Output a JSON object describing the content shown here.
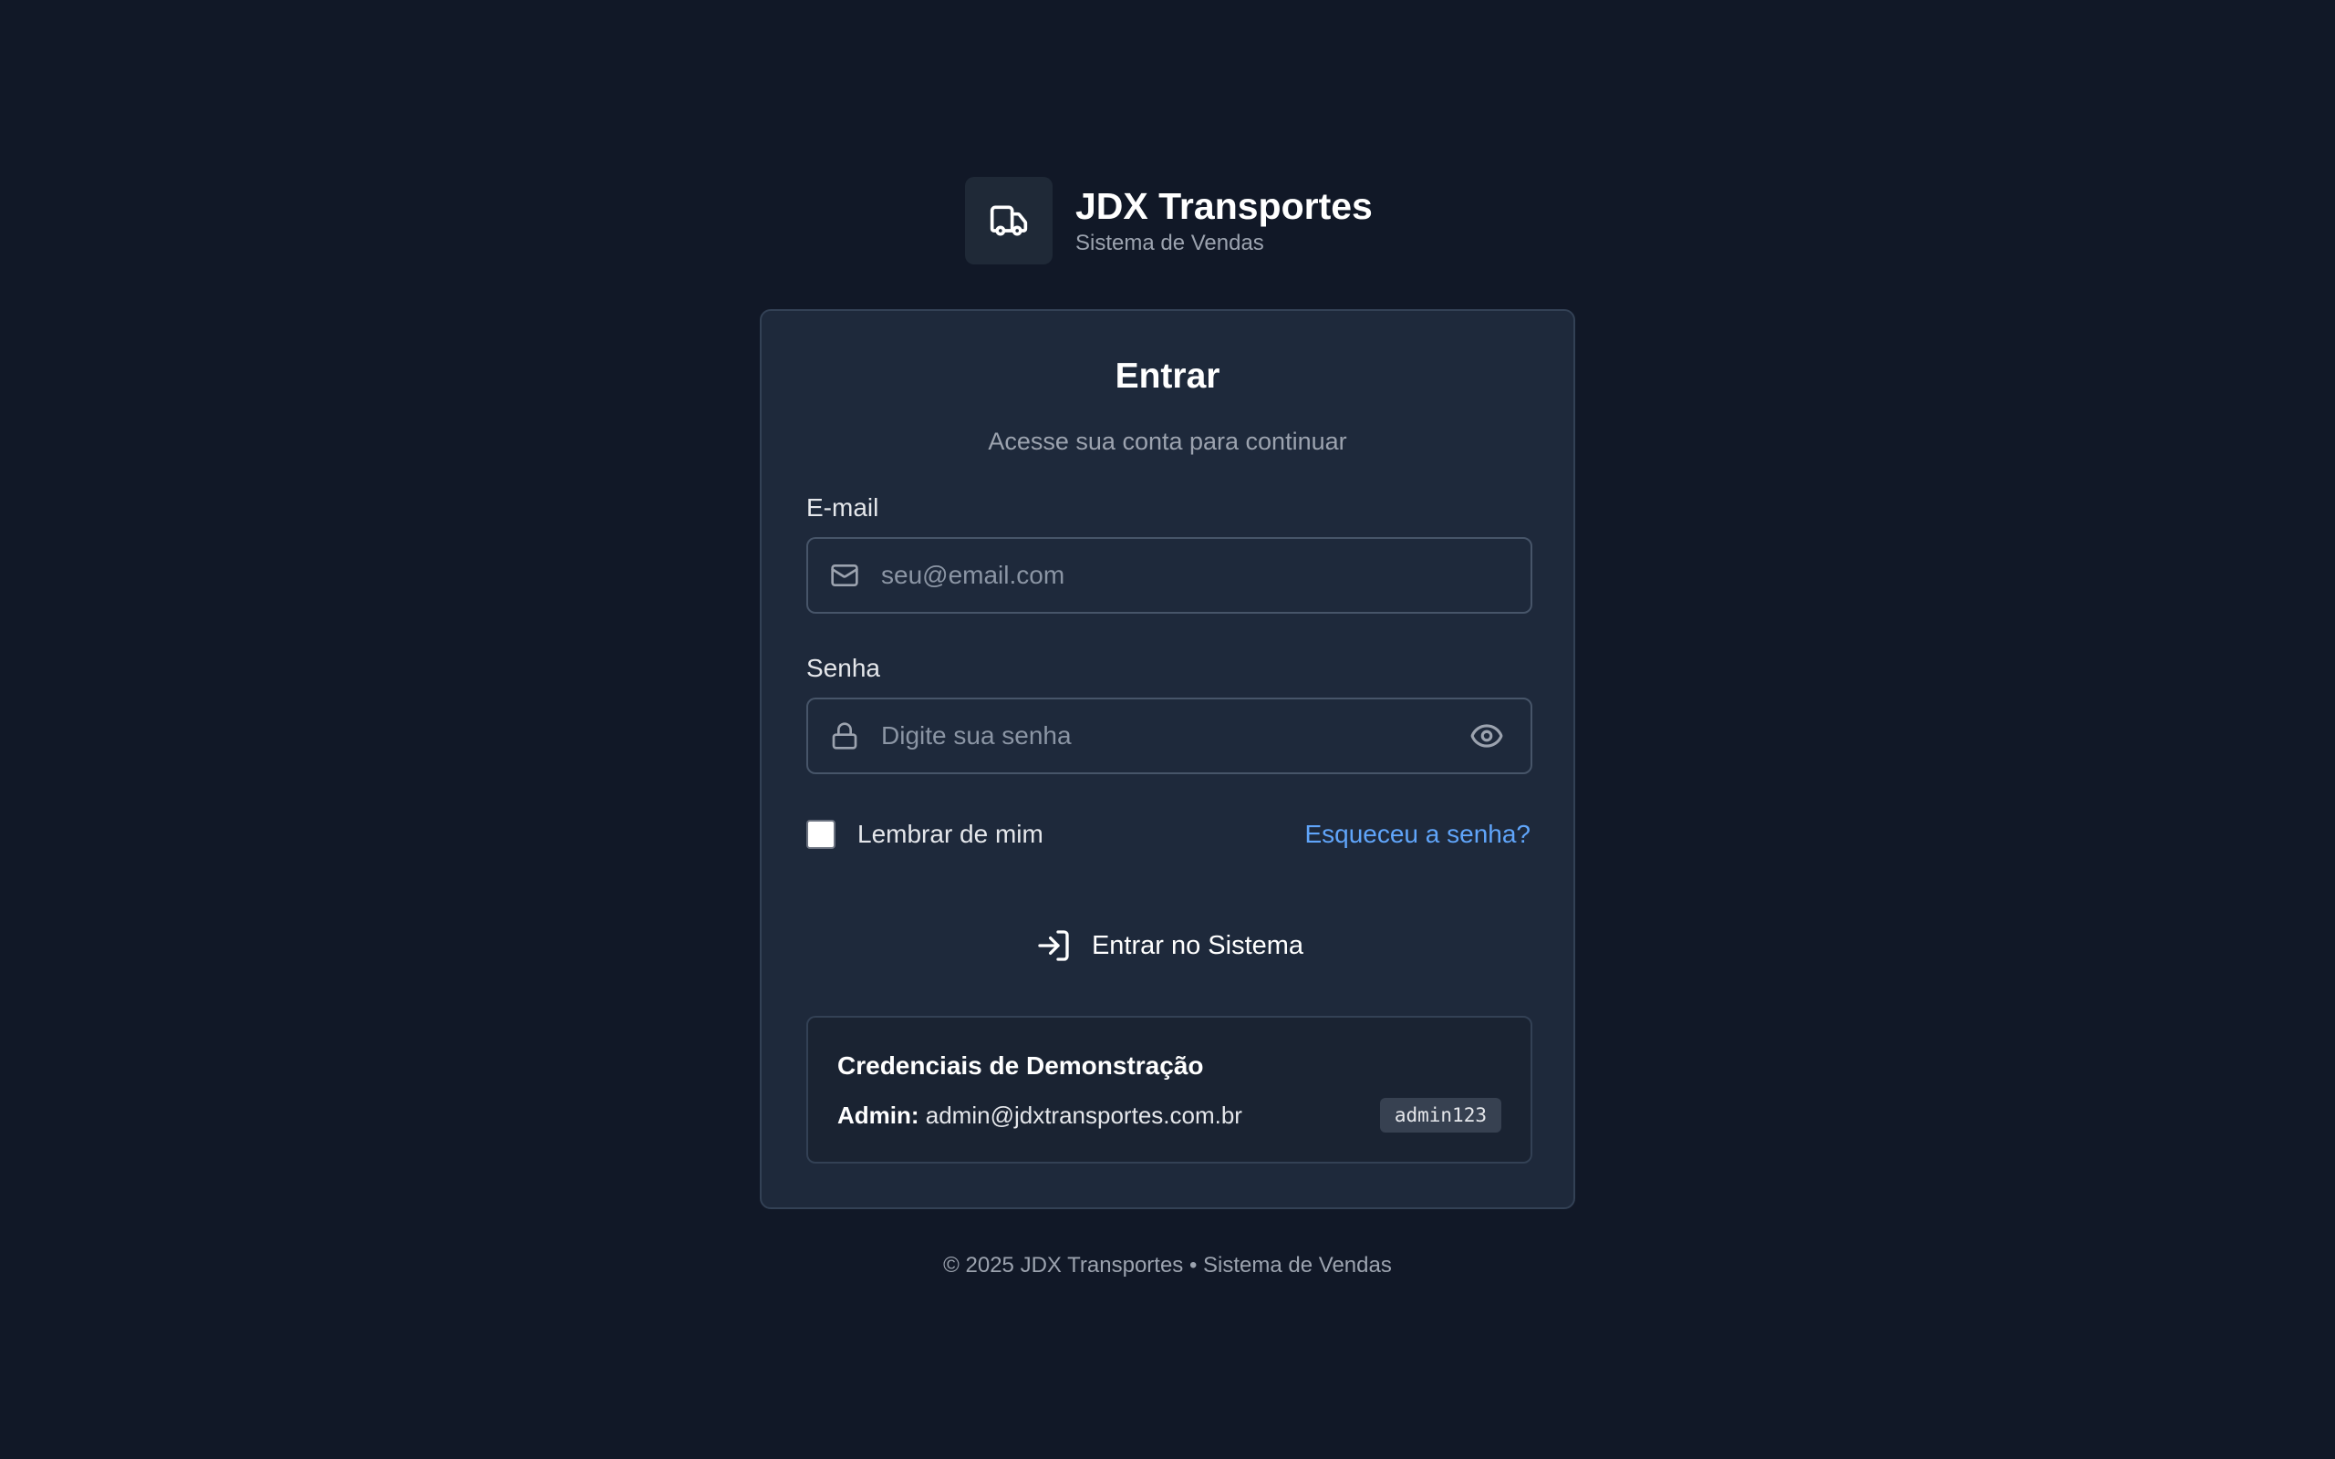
{
  "brand": {
    "title": "JDX Transportes",
    "subtitle": "Sistema de Vendas",
    "logo_icon": "truck-icon"
  },
  "login": {
    "title": "Entrar",
    "subtitle": "Acesse sua conta para continuar",
    "email": {
      "label": "E-mail",
      "placeholder": "seu@email.com",
      "value": "",
      "icon": "mail-icon"
    },
    "password": {
      "label": "Senha",
      "placeholder": "Digite sua senha",
      "value": "",
      "icon": "lock-icon",
      "toggle_icon": "eye-icon"
    },
    "remember_label": "Lembrar de mim",
    "remember_checked": false,
    "forgot_label": "Esqueceu a senha?",
    "submit_label": "Entrar no Sistema",
    "submit_icon": "log-in-icon"
  },
  "demo": {
    "title": "Credenciais de Demonstração",
    "role_label": "Admin:",
    "email": "admin@jdxtransportes.com.br",
    "password": "admin123"
  },
  "footer": {
    "text": "© 2025 JDX Transportes • Sistema de Vendas"
  },
  "colors": {
    "background": "#111827",
    "card": "#1e293b",
    "link": "#60a5fa"
  }
}
